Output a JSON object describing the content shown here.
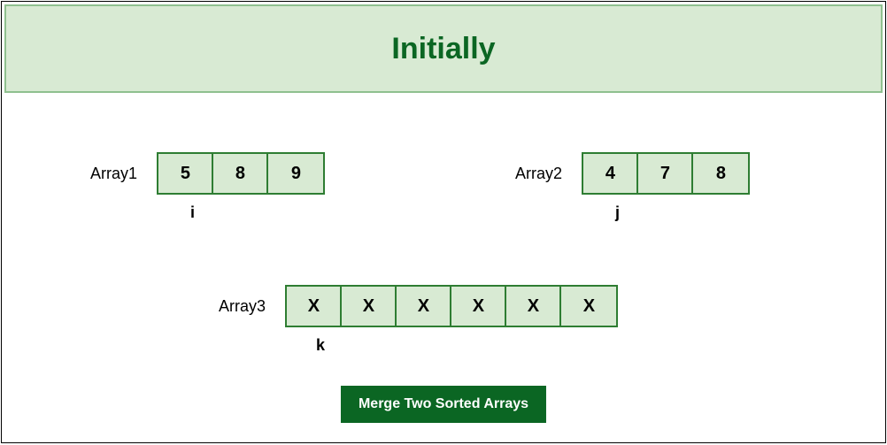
{
  "title": "Initially",
  "arrays": {
    "a1": {
      "label": "Array1",
      "values": [
        "5",
        "8",
        "9"
      ],
      "pointer": "i"
    },
    "a2": {
      "label": "Array2",
      "values": [
        "4",
        "7",
        "8"
      ],
      "pointer": "j"
    },
    "a3": {
      "label": "Array3",
      "values": [
        "X",
        "X",
        "X",
        "X",
        "X",
        "X"
      ],
      "pointer": "k"
    }
  },
  "button": "Merge Two Sorted Arrays"
}
